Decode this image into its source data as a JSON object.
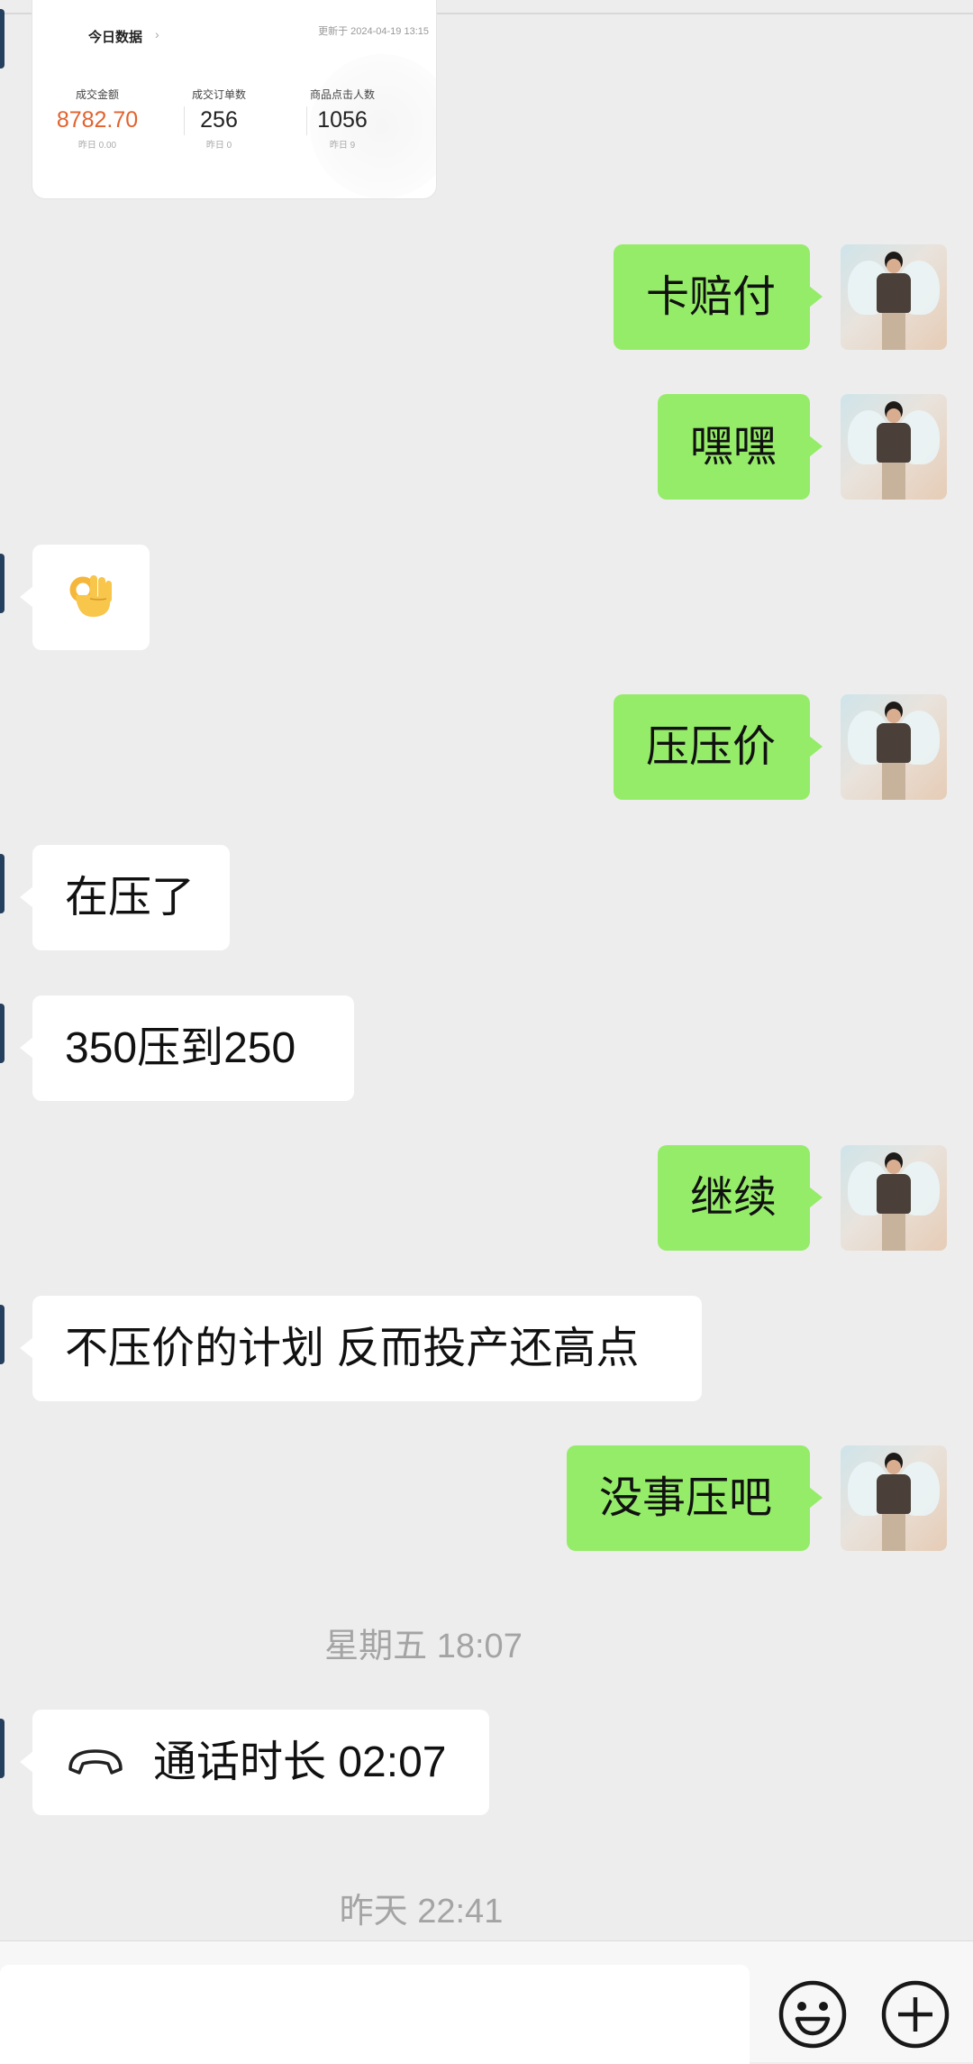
{
  "card": {
    "title": "今日数据",
    "chevron": "›",
    "updated": "更新于 2024-04-19 13:15",
    "stats": [
      {
        "label": "成交金额",
        "value": "8782.70",
        "sub": "昨日 0.00"
      },
      {
        "label": "成交订单数",
        "value": "256",
        "sub": "昨日 0"
      },
      {
        "label": "商品点击人数",
        "value": "1056",
        "sub": "昨日 9"
      }
    ]
  },
  "messages": {
    "m1": "卡赔付",
    "m2": "嘿嘿",
    "m3_emoji": "ok-hand-emoji",
    "m4": "压压价",
    "m5": "在压了",
    "m6": "350压到250",
    "m7": "继续",
    "m8": "不压价的计划  反而投产还高点",
    "m9": "没事压吧",
    "call": "通话时长 02:07"
  },
  "timestamps": {
    "t1": "星期五 18:07",
    "t2": "昨天 22:41"
  },
  "colors": {
    "sent_bubble": "#95ec69",
    "recv_bubble": "#ffffff",
    "background": "#ededed",
    "highlight_value": "#e2622e"
  },
  "icons": {
    "call": "phone-hangup-icon",
    "emoji_button": "smiley-face-icon",
    "more_button": "plus-circle-icon"
  }
}
